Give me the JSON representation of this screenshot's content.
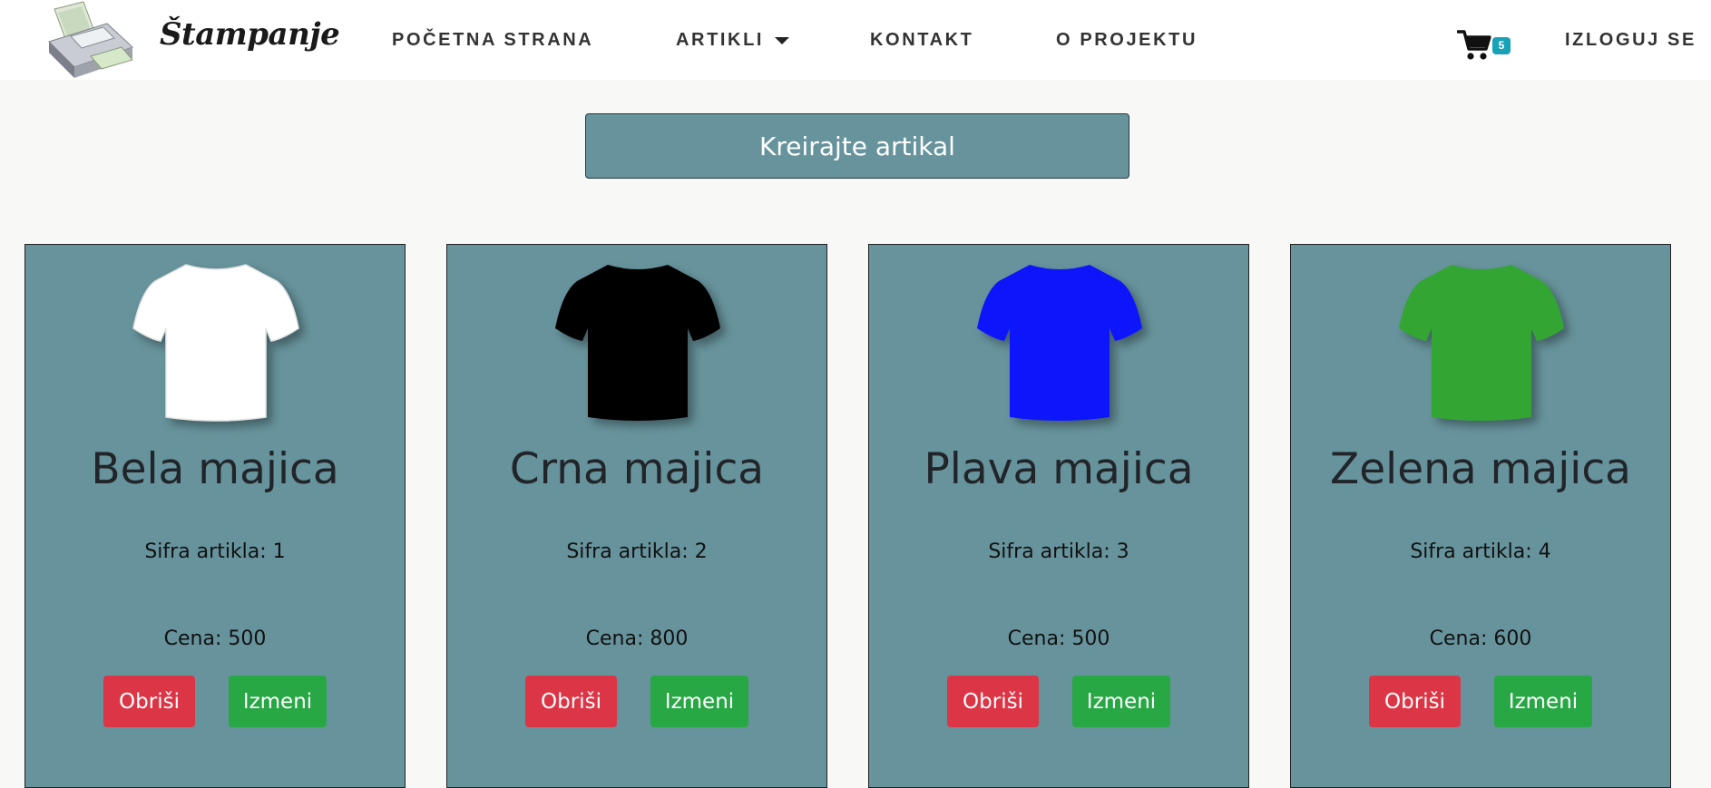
{
  "nav": {
    "brand": "Štampanje",
    "items": [
      {
        "label": "POČETNA STRANA"
      },
      {
        "label": "ARTIKLI"
      },
      {
        "label": "KONTAKT"
      },
      {
        "label": "O PROJEKTU"
      }
    ],
    "cart_count": "5",
    "logout_label": "IZLOGUJ SE"
  },
  "create_button_label": "Kreirajte artikal",
  "products": [
    {
      "title": "Bela majica",
      "code": "Sifra artikla: 1",
      "price": "Cena: 500",
      "shirt_color": "#ffffff",
      "delete_label": "Obriši",
      "edit_label": "Izmeni"
    },
    {
      "title": "Crna majica",
      "code": "Sifra artikla: 2",
      "price": "Cena: 800",
      "shirt_color": "#000000",
      "delete_label": "Obriši",
      "edit_label": "Izmeni"
    },
    {
      "title": "Plava majica",
      "code": "Sifra artikla: 3",
      "price": "Cena: 500",
      "shirt_color": "#0d16fb",
      "delete_label": "Obriši",
      "edit_label": "Izmeni"
    },
    {
      "title": "Zelena majica",
      "code": "Sifra artikla: 4",
      "price": "Cena: 600",
      "shirt_color": "#31a530",
      "delete_label": "Obriši",
      "edit_label": "Izmeni"
    }
  ],
  "icons": {
    "logo": "printer-logo-icon",
    "cart": "shopping-cart-icon",
    "dropdown": "caret-down-icon",
    "product": "tshirt-icon"
  }
}
